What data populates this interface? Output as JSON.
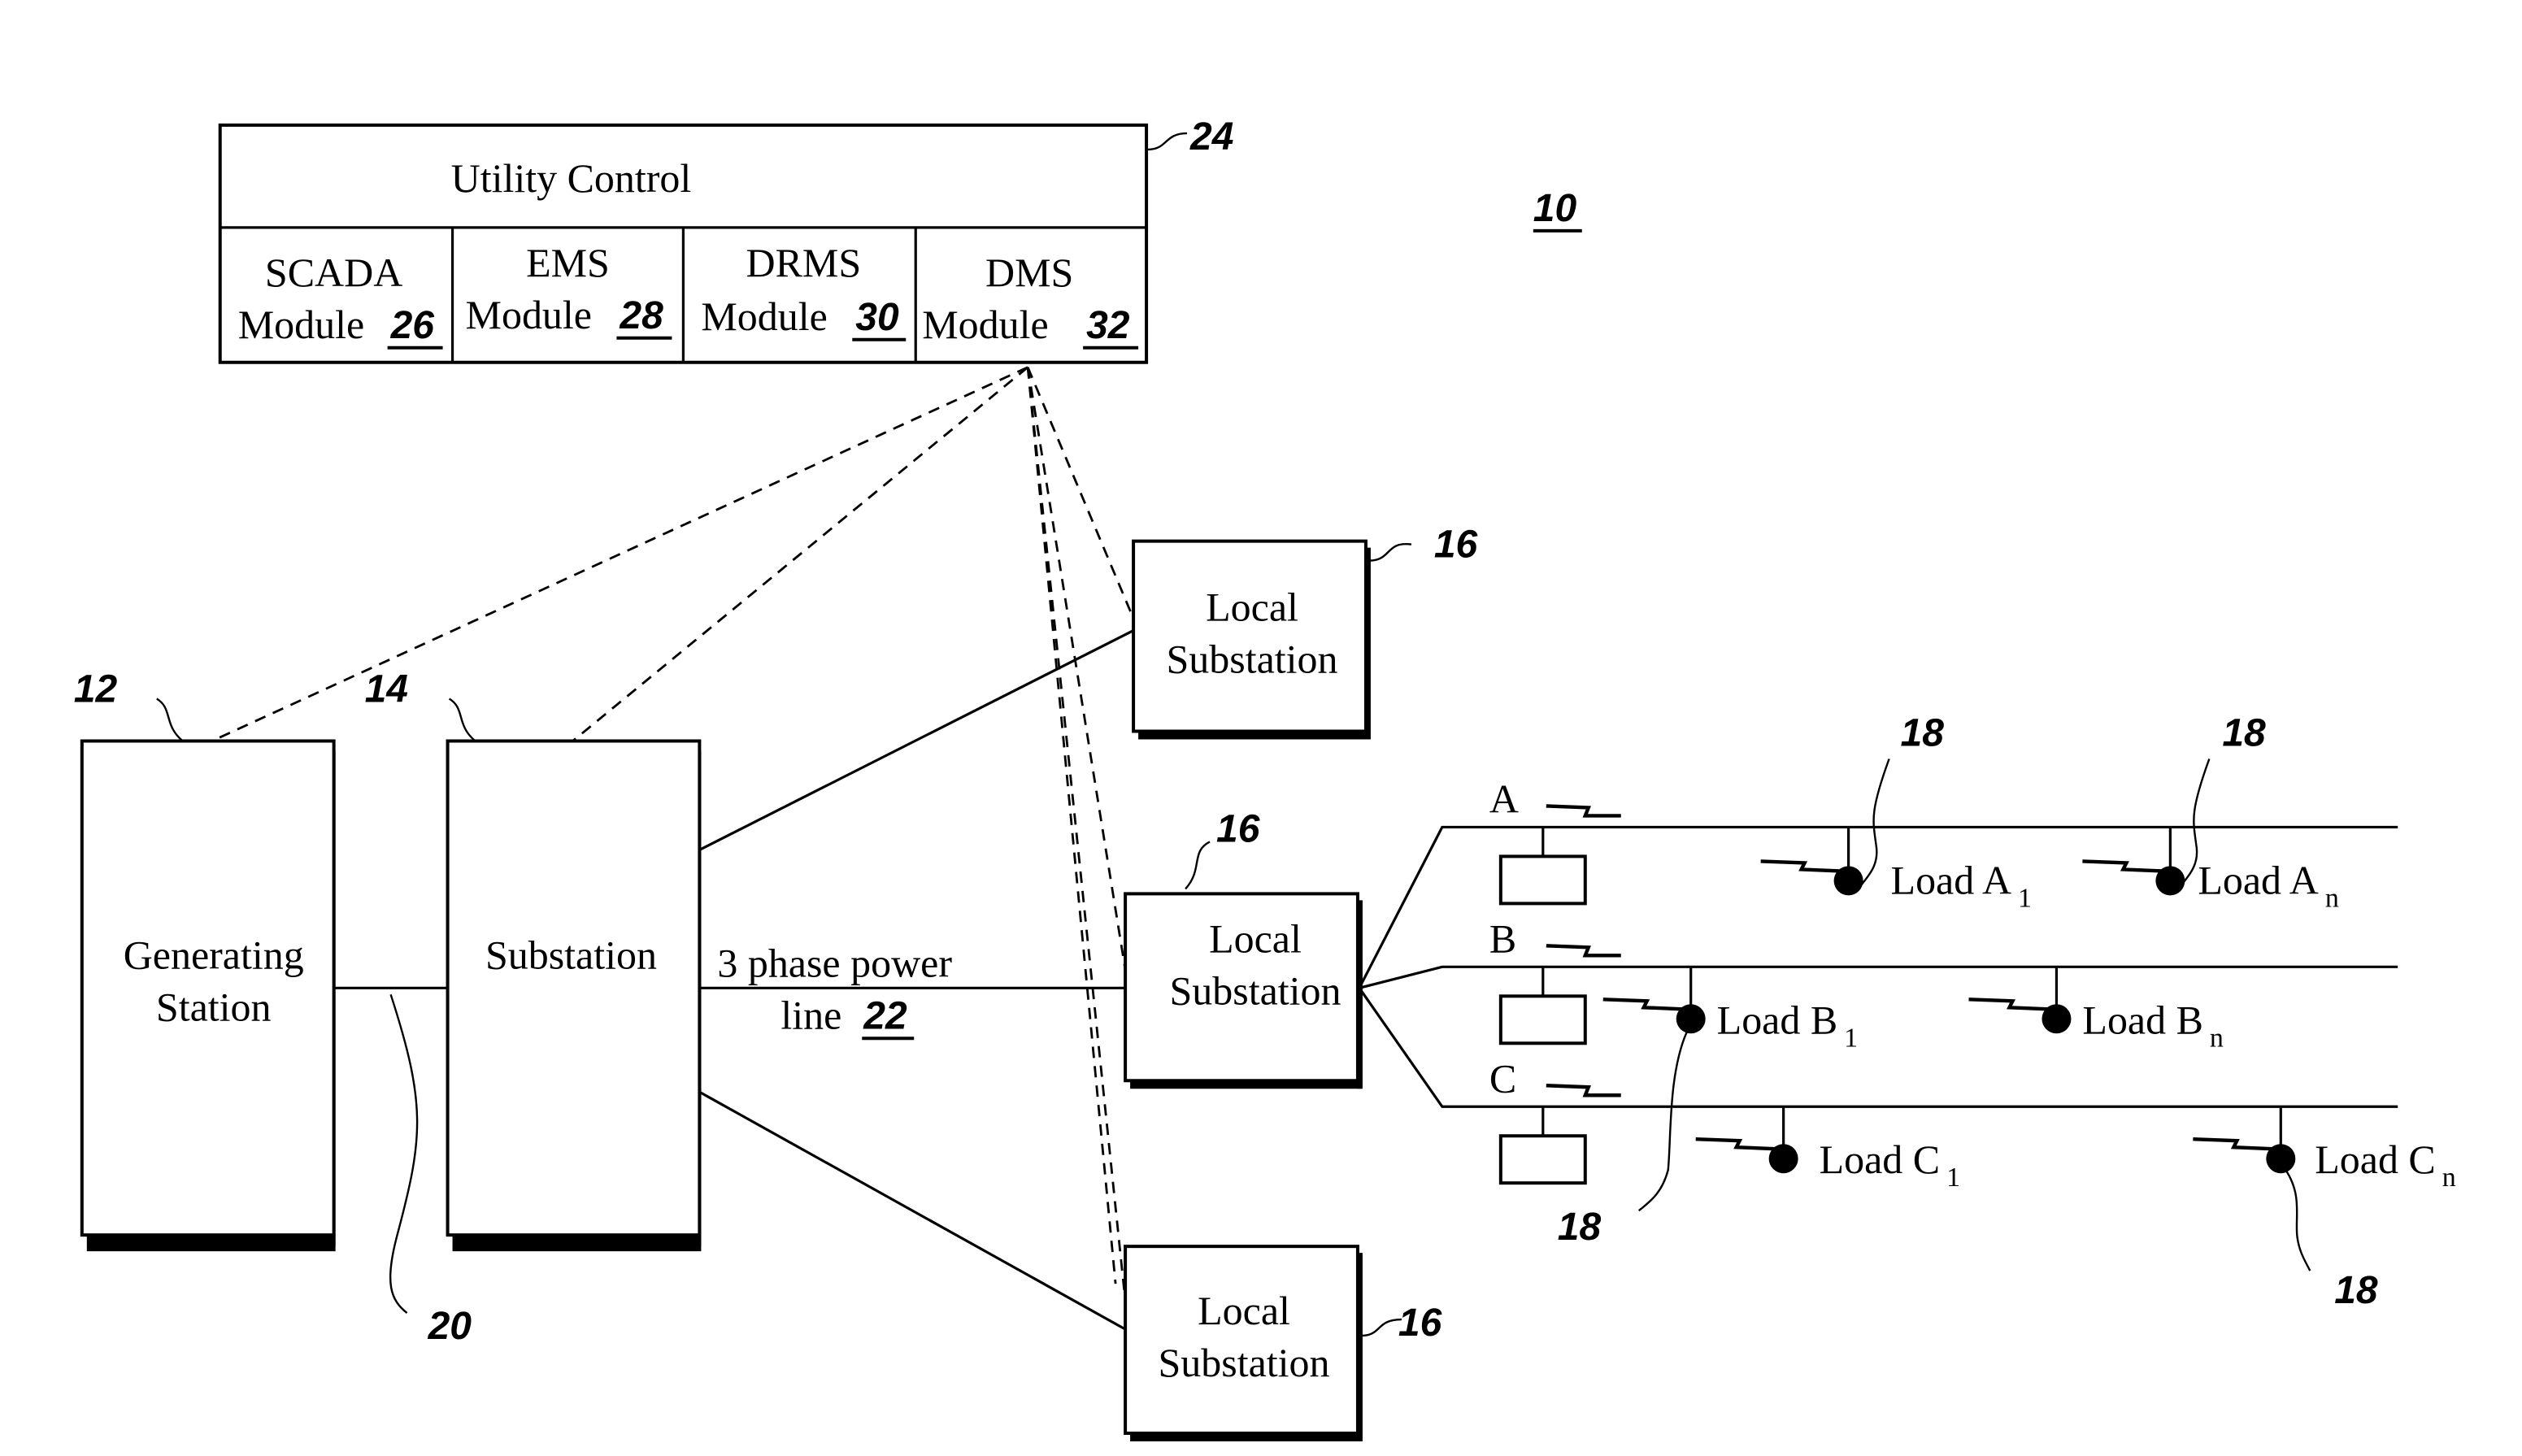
{
  "figure": {
    "ref": "10"
  },
  "utility_control": {
    "title": "Utility Control",
    "ref": "24",
    "modules": [
      {
        "line1": "SCADA",
        "line2": "Module",
        "ref": "26"
      },
      {
        "line1": "EMS",
        "line2": "Module",
        "ref": "28"
      },
      {
        "line1": "DRMS",
        "line2": "Module",
        "ref": "30"
      },
      {
        "line1": "DMS",
        "line2": "Module",
        "ref": "32"
      }
    ]
  },
  "generating_station": {
    "line1": "Generating",
    "line2": "Station",
    "ref": "12"
  },
  "substation": {
    "label": "Substation",
    "ref": "14"
  },
  "gen_link_ref": "20",
  "power_line": {
    "line1": "3 phase power",
    "line2": "line",
    "ref": "22"
  },
  "local_substations": [
    {
      "line1": "Local",
      "line2": "Substation",
      "ref": "16"
    },
    {
      "line1": "Local",
      "line2": "Substation",
      "ref": "16"
    },
    {
      "line1": "Local",
      "line2": "Substation",
      "ref": "16"
    }
  ],
  "phases": [
    {
      "label": "A",
      "loads": [
        {
          "name": "Load A",
          "sub": "1"
        },
        {
          "name": "Load A",
          "sub": "n"
        }
      ]
    },
    {
      "label": "B",
      "loads": [
        {
          "name": "Load B",
          "sub": "1"
        },
        {
          "name": "Load B",
          "sub": "n"
        }
      ]
    },
    {
      "label": "C",
      "loads": [
        {
          "name": "Load C",
          "sub": "1"
        },
        {
          "name": "Load C",
          "sub": "n"
        }
      ]
    }
  ],
  "load_refs": [
    "18",
    "18",
    "18",
    "18"
  ],
  "icons": {
    "communication": "lightning-bolt-icon",
    "load": "filled-circle",
    "meter": "rectangle"
  }
}
